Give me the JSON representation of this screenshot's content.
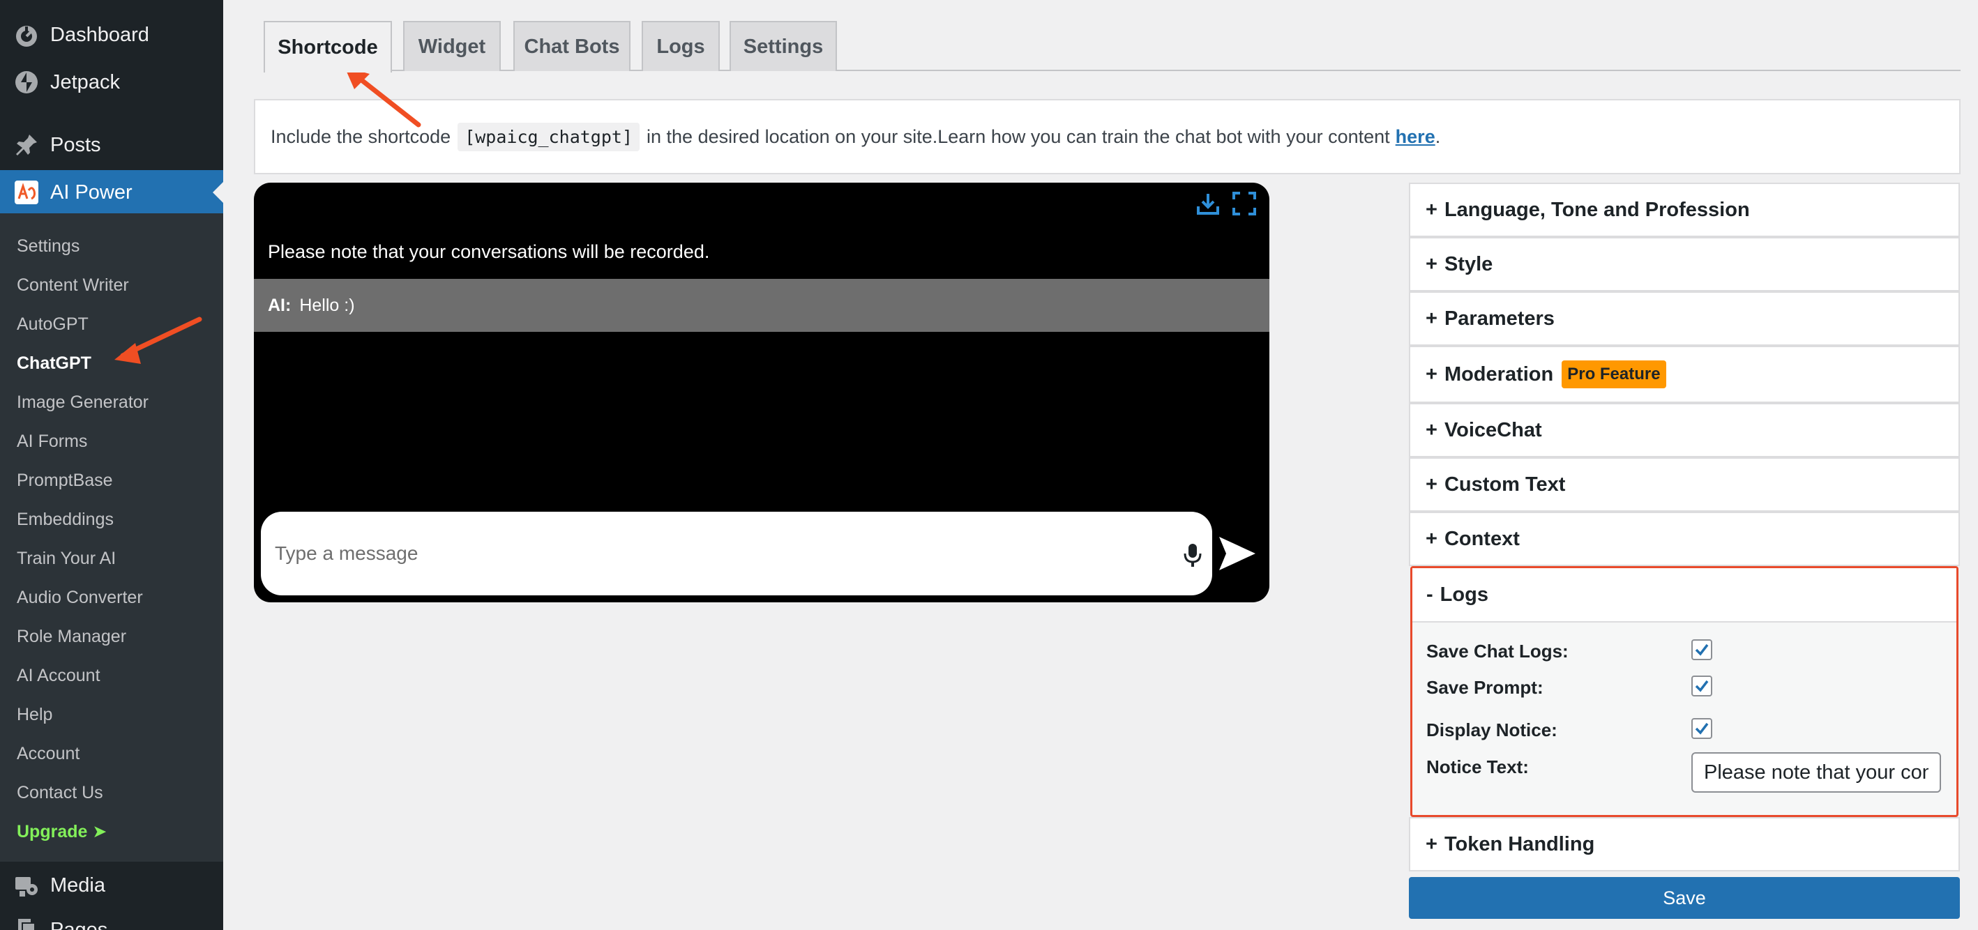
{
  "sidebar": {
    "top_items": [
      {
        "label": "Dashboard",
        "icon": "dashboard-icon"
      },
      {
        "label": "Jetpack",
        "icon": "jetpack-icon"
      },
      {
        "label": "Posts",
        "icon": "pin-icon"
      },
      {
        "label": "AI Power",
        "icon": "ai-power-icon"
      }
    ],
    "submenu": [
      "Settings",
      "Content Writer",
      "AutoGPT",
      "ChatGPT",
      "Image Generator",
      "AI Forms",
      "PromptBase",
      "Embeddings",
      "Train Your AI",
      "Audio Converter",
      "Role Manager",
      "AI Account",
      "Help",
      "Account",
      "Contact Us"
    ],
    "upgrade_label": "Upgrade ➤",
    "bottom_items": [
      {
        "label": "Media",
        "icon": "media-icon"
      },
      {
        "label": "Pages",
        "icon": "pages-icon"
      }
    ],
    "current_submenu": "ChatGPT"
  },
  "tabs": [
    "Shortcode",
    "Widget",
    "Chat Bots",
    "Logs",
    "Settings"
  ],
  "active_tab": "Shortcode",
  "notice": {
    "prefix": "Include the shortcode",
    "shortcode": "[wpaicg_chatgpt]",
    "middle": "in the desired location on your site.Learn how you can train the chat bot with your content",
    "link": "here",
    "suffix": "."
  },
  "chat": {
    "notice": "Please note that your conversations will be recorded.",
    "ai_label": "AI:",
    "ai_message": "Hello :)",
    "placeholder": "Type a message"
  },
  "accordion": {
    "language": "Language, Tone and Profession",
    "style": "Style",
    "parameters": "Parameters",
    "moderation": "Moderation",
    "pro_badge": "Pro Feature",
    "voicechat": "VoiceChat",
    "custom_text": "Custom Text",
    "context": "Context",
    "logs": "Logs",
    "token_handling": "Token Handling",
    "plus": "+",
    "minus": "-"
  },
  "logs": {
    "save_chat_logs": "Save Chat Logs:",
    "save_prompt": "Save Prompt:",
    "display_notice": "Display Notice:",
    "notice_text_label": "Notice Text:",
    "notice_text_value": "Please note that your conversations will be recorded."
  },
  "save_label": "Save",
  "colors": {
    "accent": "#2271b1",
    "highlight": "#e84a2c",
    "pro": "#ff9800",
    "upgrade": "#83f05a"
  }
}
